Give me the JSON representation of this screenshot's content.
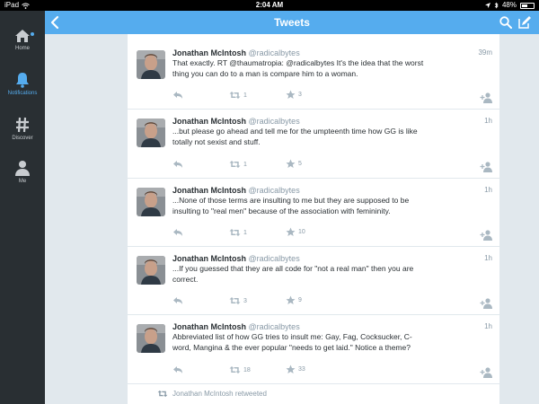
{
  "status_bar": {
    "carrier": "iPad",
    "time": "2:04 AM",
    "battery": "48%",
    "battery_level": 0.48
  },
  "sidebar": {
    "items": [
      {
        "label": "Home",
        "icon": "home-icon",
        "active": false,
        "has_notification_dot": true
      },
      {
        "label": "Notifications",
        "icon": "bell-icon",
        "active": true
      },
      {
        "label": "Discover",
        "icon": "hashtag-icon",
        "active": false
      },
      {
        "label": "Me",
        "icon": "person-icon",
        "active": false
      }
    ]
  },
  "header": {
    "title": "Tweets"
  },
  "colors": {
    "accent": "#55acee",
    "sidebar_bg": "#292f33",
    "text": "#292f33",
    "muted": "#8899a6"
  },
  "tweets": [
    {
      "name": "Jonathan McIntosh",
      "handle": "@radicalbytes",
      "time": "39m",
      "text_line1": "That exactly. RT @thaumatropia: @radicalbytes It's the idea that the worst",
      "text_line2": "thing you can do to a man is compare him to a woman.",
      "retweets": "1",
      "favorites": "3"
    },
    {
      "name": "Jonathan McIntosh",
      "handle": "@radicalbytes",
      "time": "1h",
      "text_line1": "...but please go ahead and tell me for the umpteenth time how GG is like",
      "text_line2": "totally not sexist and stuff.",
      "retweets": "1",
      "favorites": "5"
    },
    {
      "name": "Jonathan McIntosh",
      "handle": "@radicalbytes",
      "time": "1h",
      "text_line1": "...None of those terms are insulting to me but they are supposed to be",
      "text_line2": "insulting to \"real men\" because of the association with femininity.",
      "retweets": "1",
      "favorites": "10"
    },
    {
      "name": "Jonathan McIntosh",
      "handle": "@radicalbytes",
      "time": "1h",
      "text_line1": "...If you guessed that they are all code for \"not a real man\" then you are",
      "text_line2": "correct.",
      "retweets": "3",
      "favorites": "9"
    },
    {
      "name": "Jonathan McIntosh",
      "handle": "@radicalbytes",
      "time": "1h",
      "text_line1": "Abbreviated list of how GG tries to insult me: Gay, Fag, Cocksucker, C-",
      "text_line2": "word, Mangina & the ever popular \"needs to get laid.\" Notice a theme?",
      "retweets": "18",
      "favorites": "33"
    }
  ],
  "retweet_banner": {
    "label": "Jonathan McIntosh retweeted"
  }
}
